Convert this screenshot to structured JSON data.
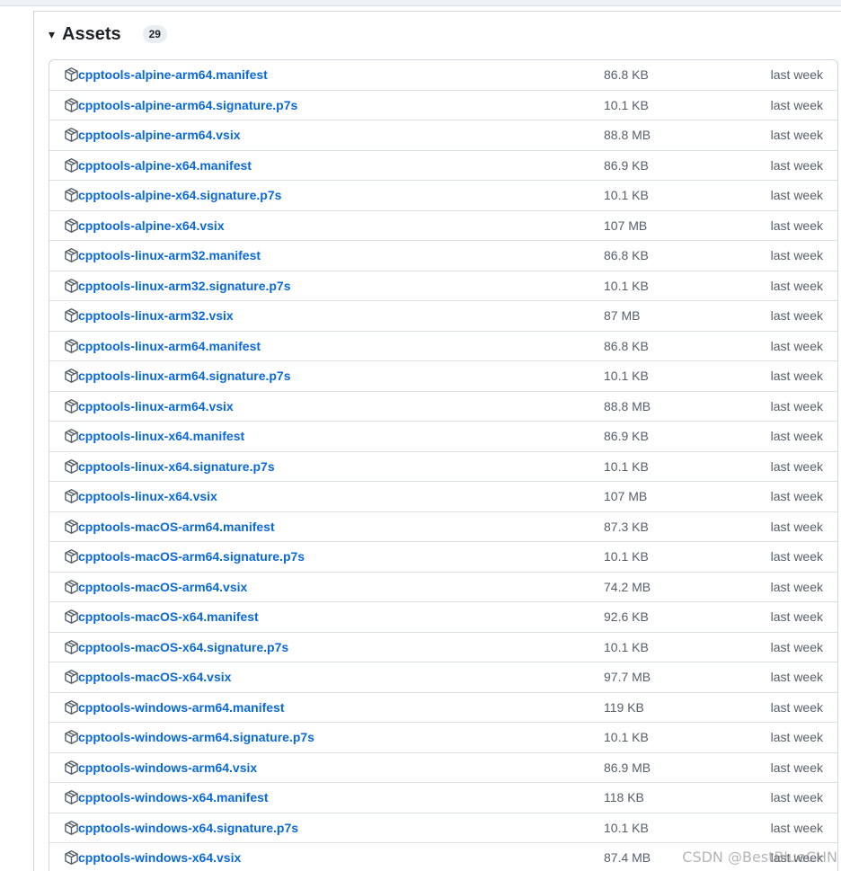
{
  "assets": {
    "title": "Assets",
    "count": "29",
    "caret": "▾",
    "icon": "package-icon",
    "items": [
      {
        "name": "cpptools-alpine-arm64.manifest",
        "size": "86.8 KB",
        "date": "last week"
      },
      {
        "name": "cpptools-alpine-arm64.signature.p7s",
        "size": "10.1 KB",
        "date": "last week"
      },
      {
        "name": "cpptools-alpine-arm64.vsix",
        "size": "88.8 MB",
        "date": "last week"
      },
      {
        "name": "cpptools-alpine-x64.manifest",
        "size": "86.9 KB",
        "date": "last week"
      },
      {
        "name": "cpptools-alpine-x64.signature.p7s",
        "size": "10.1 KB",
        "date": "last week"
      },
      {
        "name": "cpptools-alpine-x64.vsix",
        "size": "107 MB",
        "date": "last week"
      },
      {
        "name": "cpptools-linux-arm32.manifest",
        "size": "86.8 KB",
        "date": "last week"
      },
      {
        "name": "cpptools-linux-arm32.signature.p7s",
        "size": "10.1 KB",
        "date": "last week"
      },
      {
        "name": "cpptools-linux-arm32.vsix",
        "size": "87 MB",
        "date": "last week"
      },
      {
        "name": "cpptools-linux-arm64.manifest",
        "size": "86.8 KB",
        "date": "last week"
      },
      {
        "name": "cpptools-linux-arm64.signature.p7s",
        "size": "10.1 KB",
        "date": "last week"
      },
      {
        "name": "cpptools-linux-arm64.vsix",
        "size": "88.8 MB",
        "date": "last week"
      },
      {
        "name": "cpptools-linux-x64.manifest",
        "size": "86.9 KB",
        "date": "last week"
      },
      {
        "name": "cpptools-linux-x64.signature.p7s",
        "size": "10.1 KB",
        "date": "last week"
      },
      {
        "name": "cpptools-linux-x64.vsix",
        "size": "107 MB",
        "date": "last week"
      },
      {
        "name": "cpptools-macOS-arm64.manifest",
        "size": "87.3 KB",
        "date": "last week"
      },
      {
        "name": "cpptools-macOS-arm64.signature.p7s",
        "size": "10.1 KB",
        "date": "last week"
      },
      {
        "name": "cpptools-macOS-arm64.vsix",
        "size": "74.2 MB",
        "date": "last week"
      },
      {
        "name": "cpptools-macOS-x64.manifest",
        "size": "92.6 KB",
        "date": "last week"
      },
      {
        "name": "cpptools-macOS-x64.signature.p7s",
        "size": "10.1 KB",
        "date": "last week"
      },
      {
        "name": "cpptools-macOS-x64.vsix",
        "size": "97.7 MB",
        "date": "last week"
      },
      {
        "name": "cpptools-windows-arm64.manifest",
        "size": "119 KB",
        "date": "last week"
      },
      {
        "name": "cpptools-windows-arm64.signature.p7s",
        "size": "10.1 KB",
        "date": "last week"
      },
      {
        "name": "cpptools-windows-arm64.vsix",
        "size": "86.9 MB",
        "date": "last week"
      },
      {
        "name": "cpptools-windows-x64.manifest",
        "size": "118 KB",
        "date": "last week"
      },
      {
        "name": "cpptools-windows-x64.signature.p7s",
        "size": "10.1 KB",
        "date": "last week"
      },
      {
        "name": "cpptools-windows-x64.vsix",
        "size": "87.4 MB",
        "date": "last week"
      }
    ]
  },
  "watermark": "CSDN @BestBlueCHN",
  "colors": {
    "link": "#0969da",
    "muted": "#57606a",
    "border": "#d0d7de",
    "badge_bg": "#eaeef2"
  }
}
